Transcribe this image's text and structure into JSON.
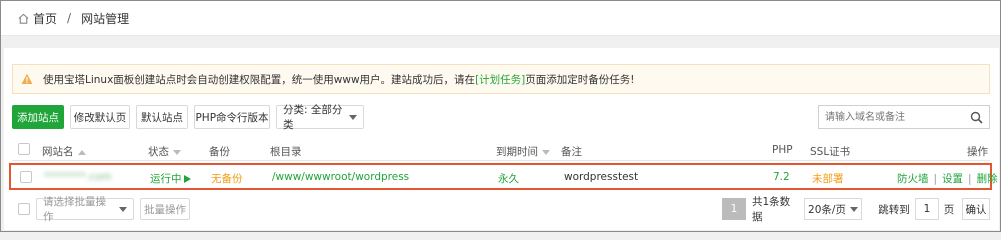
{
  "breadcrumb": {
    "home": "首页",
    "separator": "/",
    "current": "网站管理"
  },
  "notice": {
    "text_before": "使用宝塔Linux面板创建站点时会自动创建权限配置，统一使用www用户。建站成功后，请在",
    "link": "[计划任务]",
    "text_after": "页面添加定时备份任务!"
  },
  "toolbar": {
    "add_site": "添加站点",
    "modify_default_page": "修改默认页",
    "default_site": "默认站点",
    "php_cli_version": "PHP命令行版本",
    "category_select": "分类: 全部分类",
    "search_placeholder": "请输入域名或备注"
  },
  "table": {
    "headers": {
      "site_name": "网站名",
      "status": "状态",
      "backup": "备份",
      "root_dir": "根目录",
      "expire": "到期时间",
      "remark": "备注",
      "php": "PHP",
      "ssl": "SSL证书",
      "action": "操作"
    },
    "rows": [
      {
        "site_name": "********.com",
        "status": "运行中",
        "backup": "无备份",
        "root_dir": "/www/wwwroot/wordpress",
        "expire": "永久",
        "remark": "wordpresstest",
        "php": "7.2",
        "ssl": "未部署",
        "actions": {
          "firewall": "防火墙",
          "settings": "设置",
          "delete": "删除"
        }
      }
    ]
  },
  "footer": {
    "batch_select": "请选择批量操作",
    "batch_button": "批量操作",
    "current_page": "1",
    "total": "共1条数据",
    "per_page": "20条/页",
    "jump_to": "跳转到",
    "jump_value": "1",
    "page_unit": "页",
    "confirm": "确认"
  },
  "colors": {
    "accent": "#20a53a",
    "warning": "#f39c12",
    "highlight": "#e2572f"
  }
}
